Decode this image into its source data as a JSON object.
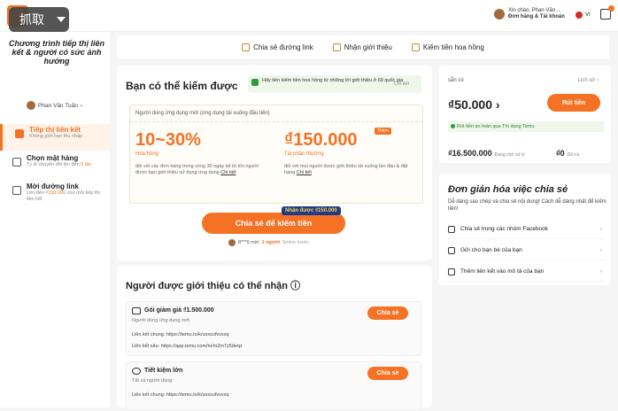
{
  "capture": {
    "label": "抓取"
  },
  "header": {
    "greeting": "Xin chào, Phan Văn ...",
    "account_label": "Đơn hàng & Tài khoản",
    "lang": "VI"
  },
  "sidebar": {
    "title": "Chương trình tiếp thị liên kết & người có sức ảnh hưởng",
    "user": "Phan Văn Tuấn",
    "items": [
      {
        "label": "Tiếp thị liên kết",
        "sub": "Không giới hạn thu nhập"
      },
      {
        "label": "Chọn mặt hàng",
        "sub": "Tỷ lệ chuyển đổi lên đến",
        "sub_em": "5 lần"
      },
      {
        "label": "Mời đường link",
        "sub": "Lên đến",
        "sub_em": "₫150.000",
        "sub2": "cho mỗi tiếp thị liên kết"
      }
    ]
  },
  "tabs": [
    {
      "label": "Chia sẻ đường link"
    },
    {
      "label": "Nhận giới thiệu"
    },
    {
      "label": "Kiếm tiền hoa hồng"
    }
  ],
  "earn": {
    "title": "Bạn có thể kiếm được",
    "reward_note": "Hãy tiền kiếm tiền hoa hồng từ những lời giới thiệu ở 69 quốc gia",
    "reward_more": "Chi tiết",
    "box_top": "Người dùng ứng dụng mới (ứng dụng tải xuống đầu tiên)",
    "commission": {
      "value": "10~30%",
      "label": "Hoa hồng",
      "desc": "đối với các đơn hàng trong vòng 30 ngày kể từ khi người được bạn giới thiệu sử dụng ứng dụng",
      "more": "Chi tiết"
    },
    "reward": {
      "value": "₫150.000",
      "label": "Tài phần thưởng",
      "badge": "Thêm",
      "desc": "đối với mọi người được giới thiệu tải xuống lần đầu & đặt hàng",
      "more": "Chi tiết"
    },
    "share_button": "Chia sẻ để kiếm tiền",
    "pill": "Nhận được ₫150.000",
    "ticker": {
      "user": "8***9 mời",
      "count": "1 người",
      "time": "5mins trước"
    }
  },
  "referral": {
    "title": "Người được giới thiệu có thể nhận",
    "cards": [
      {
        "name": "Gói giảm giá ₫1.500.000",
        "sub": "Người dùng ứng dụng mới",
        "button": "Chia sẻ",
        "link1": "Liên kết chung: https://temu.to/k/uxxsufvvxxq",
        "link2": "Liên kết sâu: https://app.temu.com/m/m2m7y5deqz"
      },
      {
        "name": "Tiết kiệm lớn",
        "sub": "Tất cả người dùng",
        "button": "Chia sẻ",
        "link1": "Liên kết chung: https://temu.to/k/uxxsufvvxxq"
      }
    ]
  },
  "balance": {
    "available_label": "sẵn có",
    "history": "Lịch sử",
    "amount": "₫50.000",
    "withdraw": "Rút tiền",
    "safe_note": "Rút tiền an toàn qua  Tín dụng Temu",
    "pending_amount": "₫16.500.000",
    "pending_label": "Đang chờ xử lý",
    "withdrawn_amount": "₫0",
    "withdrawn_label": "Đã rút"
  },
  "simplify": {
    "title": "Đơn giản hóa việc chia sẻ",
    "desc": "Dễ dàng sao chép và chia sẻ nội dung! Cách dễ dàng nhất để kiếm tiền!",
    "rows": [
      {
        "label": "Chia sẻ trong các nhóm Facebook"
      },
      {
        "label": "Gửi cho bạn bè của bạn"
      },
      {
        "label": "Thêm liên kết vào mô tả của bạn"
      }
    ]
  }
}
